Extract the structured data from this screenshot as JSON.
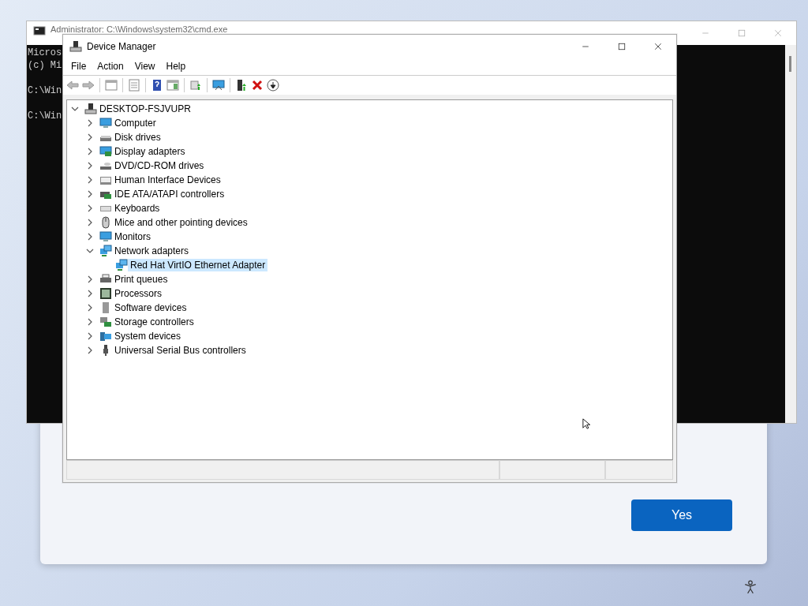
{
  "background_dialog": {
    "buttons": [
      {
        "label": "Yes"
      }
    ]
  },
  "console_window": {
    "title": "Administrator: C:\\Windows\\system32\\cmd.exe",
    "blocks": [
      [
        "Micros",
        "(c) Mi"
      ],
      [
        "C:\\Win"
      ],
      [
        "C:\\Win"
      ]
    ]
  },
  "device_manager": {
    "title": "Device Manager",
    "menu": [
      "File",
      "Action",
      "View",
      "Help"
    ],
    "tree": {
      "label": "DESKTOP-FSJVUPR",
      "expanded": true,
      "selected": false,
      "children": [
        {
          "label": "Computer",
          "expanded": false,
          "selected": false
        },
        {
          "label": "Disk drives",
          "expanded": false,
          "selected": false
        },
        {
          "label": "Display adapters",
          "expanded": false,
          "selected": false
        },
        {
          "label": "DVD/CD-ROM drives",
          "expanded": false,
          "selected": false
        },
        {
          "label": "Human Interface Devices",
          "expanded": false,
          "selected": false
        },
        {
          "label": "IDE ATA/ATAPI controllers",
          "expanded": false,
          "selected": false
        },
        {
          "label": "Keyboards",
          "expanded": false,
          "selected": false
        },
        {
          "label": "Mice and other pointing devices",
          "expanded": false,
          "selected": false
        },
        {
          "label": "Monitors",
          "expanded": false,
          "selected": false
        },
        {
          "label": "Network adapters",
          "expanded": true,
          "selected": false,
          "children": [
            {
              "label": "Red Hat VirtIO Ethernet Adapter",
              "selected": true
            }
          ]
        },
        {
          "label": "Print queues",
          "expanded": false,
          "selected": false
        },
        {
          "label": "Processors",
          "expanded": false,
          "selected": false
        },
        {
          "label": "Software devices",
          "expanded": false,
          "selected": false
        },
        {
          "label": "Storage controllers",
          "expanded": false,
          "selected": false
        },
        {
          "label": "System devices",
          "expanded": false,
          "selected": false
        },
        {
          "label": "Universal Serial Bus controllers",
          "expanded": false,
          "selected": false
        }
      ]
    }
  }
}
